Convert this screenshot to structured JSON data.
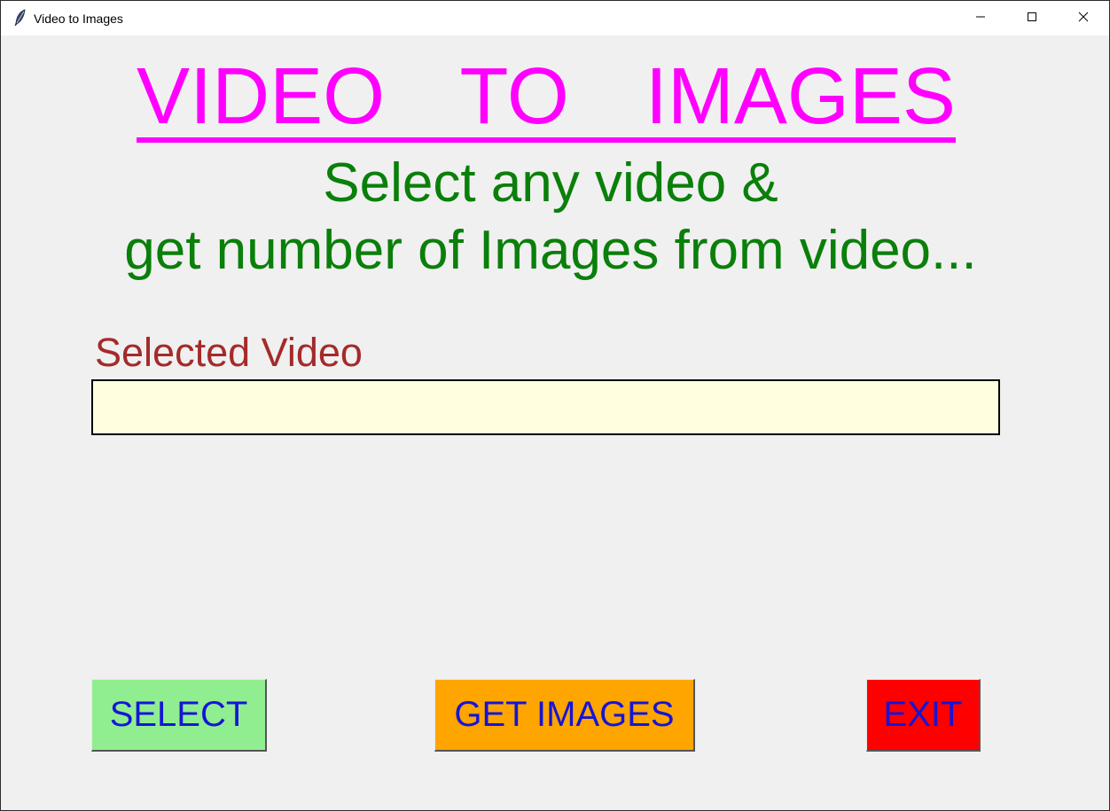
{
  "window": {
    "title": "Video to Images",
    "app_icon": "feather-icon",
    "controls": {
      "minimize": "minimize-icon",
      "maximize": "maximize-icon",
      "close": "close-icon"
    }
  },
  "main": {
    "heading": "VIDEO  TO  IMAGES",
    "subtitle_line1": "Select any video &",
    "subtitle_line2": "get number of Images from video...",
    "selected_label": "Selected Video",
    "selected_value": ""
  },
  "buttons": {
    "select": "SELECT",
    "get_images": "GET IMAGES",
    "exit": "EXIT"
  },
  "colors": {
    "heading": "#ff00ff",
    "subtitle": "#0a7f0a",
    "label": "#a52a2a",
    "input_bg": "#ffffe0",
    "button_text": "#1515d6",
    "select_bg": "#90ee90",
    "get_images_bg": "#ffa500",
    "exit_bg": "#ff0000"
  }
}
